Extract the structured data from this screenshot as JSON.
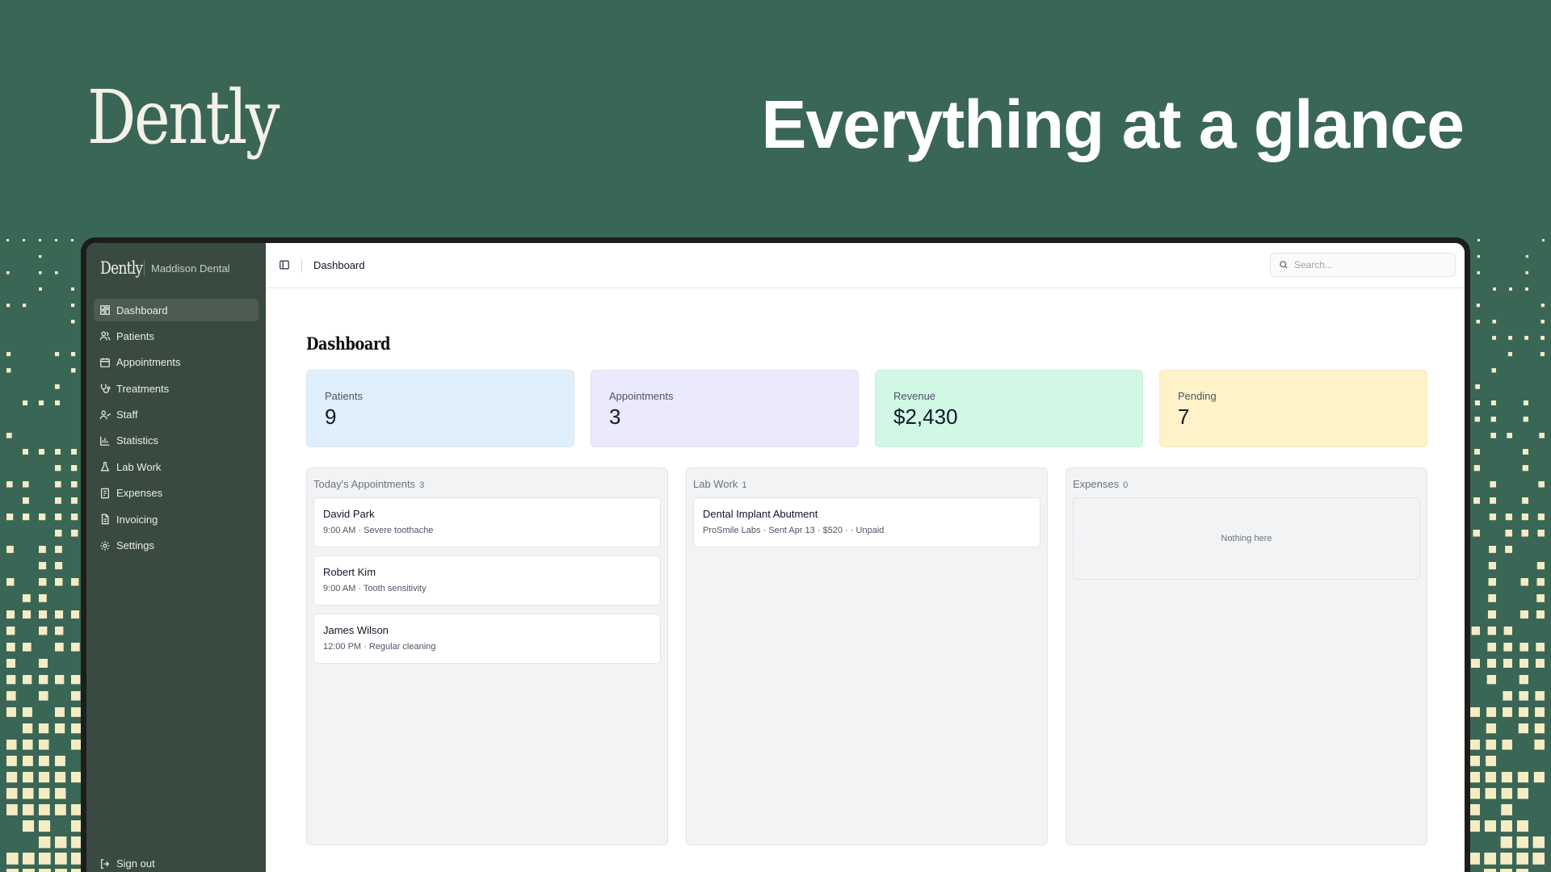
{
  "hero": {
    "logo": "Dently",
    "title": "Everything at a glance"
  },
  "colors": {
    "background": "#3a6656",
    "sidebar": "#394a41",
    "patients_card": "#dfeffb",
    "appointments_card": "#ebe9fc",
    "revenue_card": "#d1f8e4",
    "pending_card": "#fdf2c8",
    "pixel_deco": "#f5ecc4"
  },
  "sidebar": {
    "logo": "Dently",
    "clinic": "Maddison Dental",
    "items": [
      {
        "label": "Dashboard",
        "icon": "dashboard-icon",
        "active": true
      },
      {
        "label": "Patients",
        "icon": "users-icon"
      },
      {
        "label": "Appointments",
        "icon": "calendar-icon"
      },
      {
        "label": "Treatments",
        "icon": "stethoscope-icon"
      },
      {
        "label": "Staff",
        "icon": "user-check-icon"
      },
      {
        "label": "Statistics",
        "icon": "bar-chart-icon"
      },
      {
        "label": "Lab Work",
        "icon": "flask-icon"
      },
      {
        "label": "Expenses",
        "icon": "receipt-icon"
      },
      {
        "label": "Invoicing",
        "icon": "file-text-icon"
      },
      {
        "label": "Settings",
        "icon": "gear-icon"
      }
    ],
    "signout": "Sign out"
  },
  "topbar": {
    "breadcrumb": "Dashboard",
    "search_placeholder": "Search..."
  },
  "main": {
    "title": "Dashboard",
    "stats": [
      {
        "label": "Patients",
        "value": "9"
      },
      {
        "label": "Appointments",
        "value": "3"
      },
      {
        "label": "Revenue",
        "value": "$2,430"
      },
      {
        "label": "Pending",
        "value": "7"
      }
    ],
    "appointments": {
      "title": "Today's Appointments",
      "count": "3",
      "items": [
        {
          "name": "David Park",
          "meta": "9:00 AM · Severe toothache"
        },
        {
          "name": "Robert Kim",
          "meta": "9:00 AM · Tooth sensitivity"
        },
        {
          "name": "James Wilson",
          "meta": "12:00 PM · Regular cleaning"
        }
      ]
    },
    "lab_work": {
      "title": "Lab Work",
      "count": "1",
      "items": [
        {
          "name": "Dental Implant Abutment",
          "meta": "ProSmile Labs · Sent Apr 13 · $520 · · Unpaid"
        }
      ]
    },
    "expenses": {
      "title": "Expenses",
      "count": "0",
      "empty": "Nothing here"
    }
  }
}
